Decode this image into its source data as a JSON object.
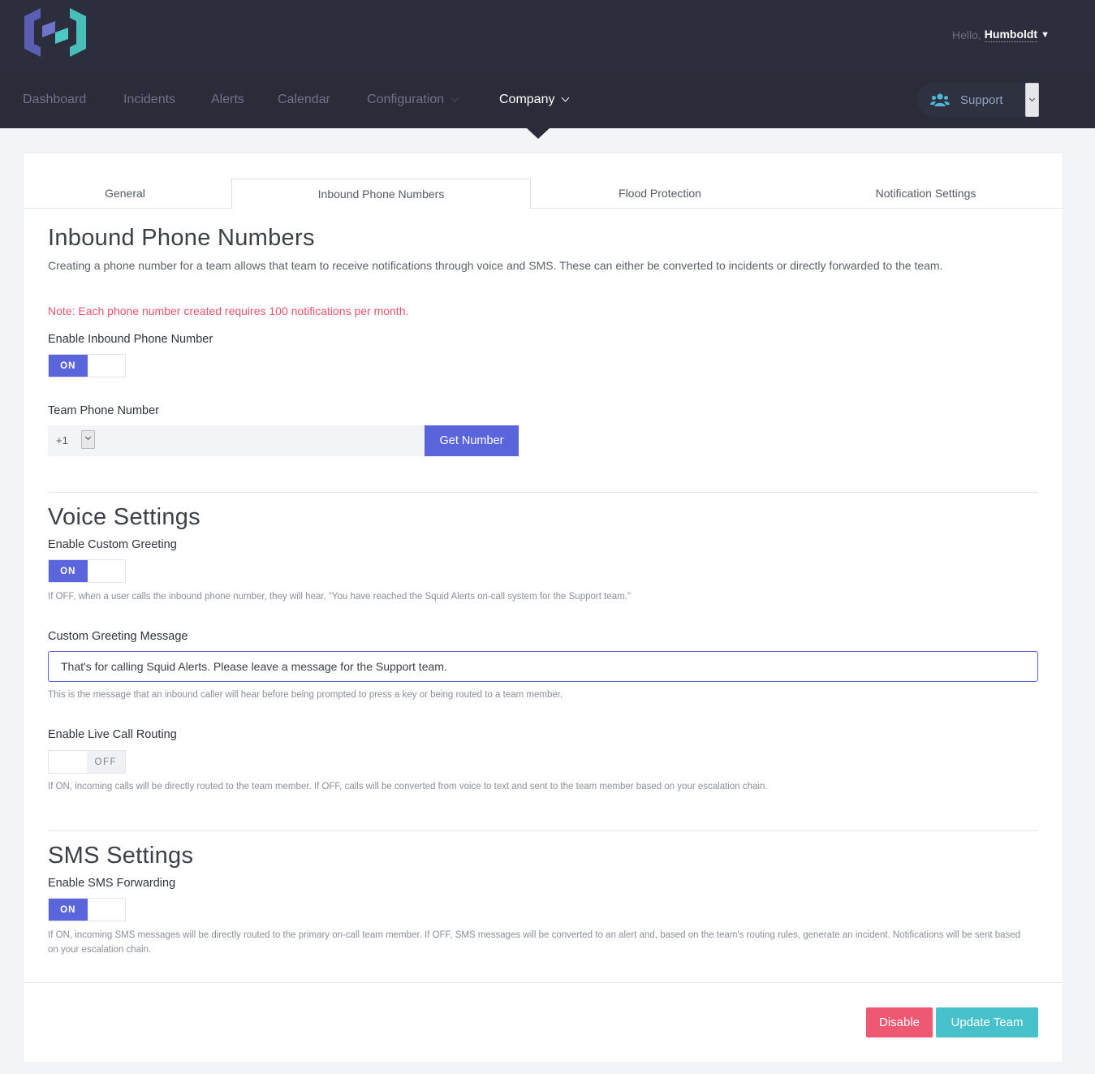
{
  "header": {
    "greeting": "Hello,",
    "username": "Humboldt",
    "logo_icon": "squid-alerts-logo-icon"
  },
  "nav": {
    "items": [
      {
        "label": "Dashboard"
      },
      {
        "label": "Incidents"
      },
      {
        "label": "Alerts"
      },
      {
        "label": "Calendar"
      },
      {
        "label": "Configuration"
      },
      {
        "label": "Company"
      }
    ],
    "active": "Company",
    "team_selector": "Support"
  },
  "tabs": [
    {
      "label": "General"
    },
    {
      "label": "Inbound Phone Numbers"
    },
    {
      "label": "Flood Protection"
    },
    {
      "label": "Notification Settings"
    }
  ],
  "inbound": {
    "title": "Inbound Phone Numbers",
    "description": "Creating a phone number for a team allows that team to receive notifications through voice and SMS. These can either be converted to incidents or directly forwarded to the team.",
    "note": "Note: Each phone number created requires 100 notifications per month.",
    "enable_label": "Enable Inbound Phone Number",
    "enable_state": "ON",
    "phone_label": "Team Phone Number",
    "country_code": "+1",
    "phone_value": "",
    "get_number_label": "Get Number"
  },
  "voice": {
    "title": "Voice Settings",
    "custom_greeting_label": "Enable Custom Greeting",
    "custom_greeting_state": "ON",
    "custom_greeting_help": "If OFF, when a user calls the inbound phone number, they will hear, \"You have reached the Squid Alerts on-call system for the Support team.\"",
    "greeting_message_label": "Custom Greeting Message",
    "greeting_message_value": "That's for calling Squid Alerts. Please leave a message for the Support team.",
    "greeting_message_help": "This is the message that an inbound caller will hear before being prompted to press a key or being routed to a team member.",
    "live_routing_label": "Enable Live Call Routing",
    "live_routing_state": "OFF",
    "live_routing_help": "If ON, incoming calls will be directly routed to the team member. If OFF, calls will be converted from voice to text and sent to the team member based on your escalation chain."
  },
  "sms": {
    "title": "SMS Settings",
    "forwarding_label": "Enable SMS Forwarding",
    "forwarding_state": "ON",
    "forwarding_help": "If ON, incoming SMS messages will be directly routed to the primary on-call team member. If OFF, SMS messages will be converted to an alert and, based on the team's routing rules, generate an incident. Notifications will be sent based on your escalation chain."
  },
  "actions": {
    "disable_label": "Disable",
    "update_label": "Update Team"
  },
  "colors": {
    "primary": "#5a65dc",
    "danger": "#ee5872",
    "info": "#47c1cb",
    "header_bg": "#2c2e3e",
    "note": "#e8546d"
  }
}
